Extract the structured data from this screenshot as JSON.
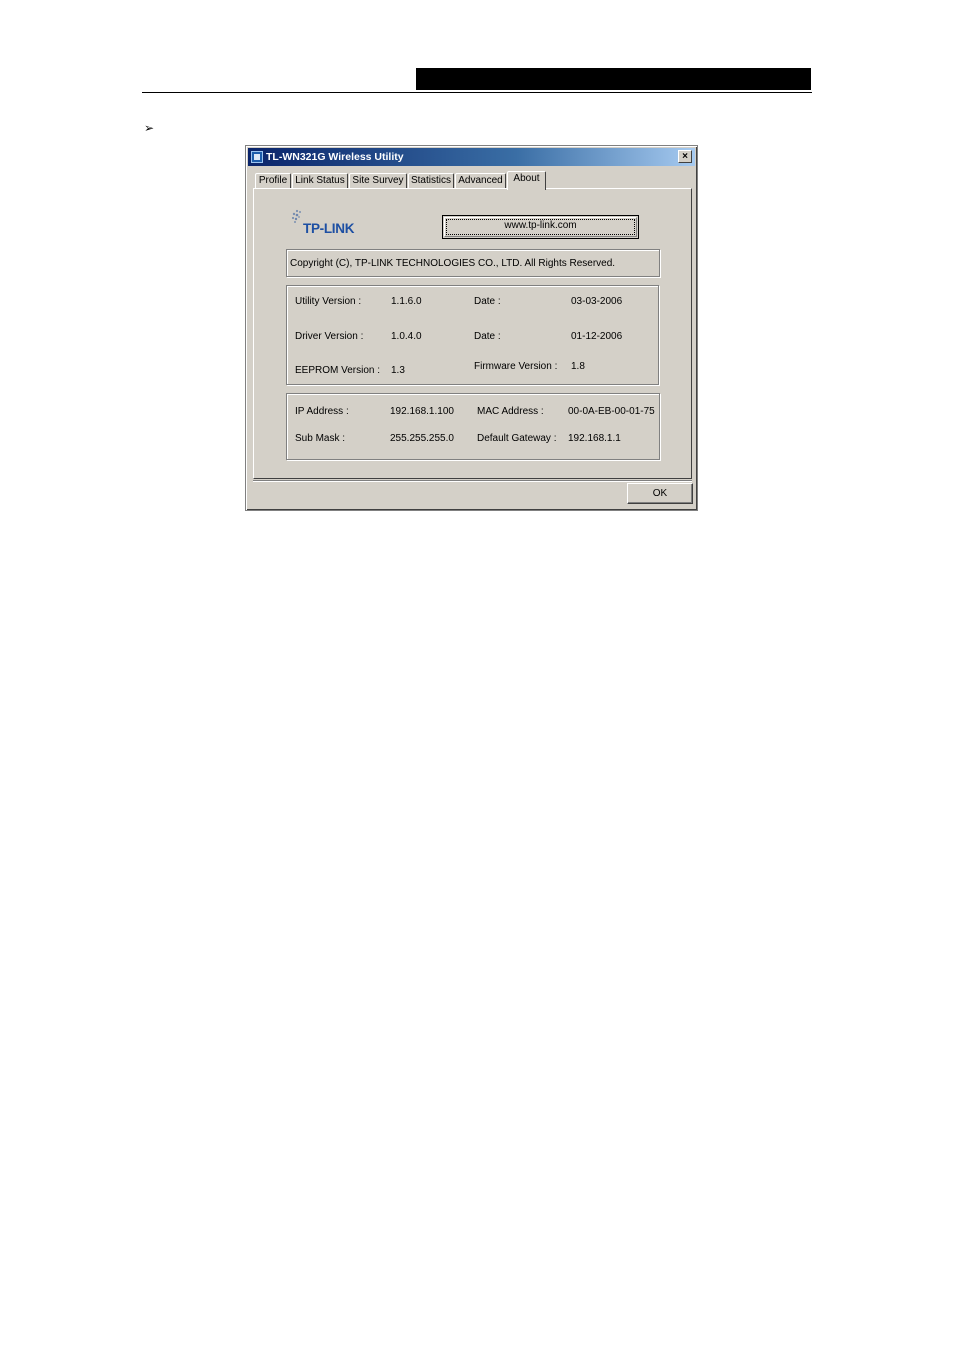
{
  "document": {
    "bullet": "Ø"
  },
  "window": {
    "title": "TL-WN321G Wireless Utility",
    "close_label": "×"
  },
  "tabs": [
    {
      "label": "Profile"
    },
    {
      "label": "Link Status"
    },
    {
      "label": "Site Survey"
    },
    {
      "label": "Statistics"
    },
    {
      "label": "Advanced"
    },
    {
      "label": "About",
      "active": true
    }
  ],
  "about": {
    "logo_text": "TP-LINK",
    "website_button": "www.tp-link.com",
    "copyright": "Copyright (C), TP-LINK TECHNOLOGIES CO., LTD. All Rights Reserved.",
    "versions": {
      "utility_label": "Utility Version :",
      "utility_value": "1.1.6.0",
      "utility_date_label": "Date :",
      "utility_date_value": "03-03-2006",
      "driver_label": "Driver Version :",
      "driver_value": "1.0.4.0",
      "driver_date_label": "Date :",
      "driver_date_value": "01-12-2006",
      "eeprom_label": "EEPROM Version :",
      "eeprom_value": "1.3",
      "firmware_label": "Firmware Version :",
      "firmware_value": "1.8"
    },
    "network": {
      "ip_label": "IP Address :",
      "ip_value": "192.168.1.100",
      "mac_label": "MAC Address :",
      "mac_value": "00-0A-EB-00-01-75",
      "mask_label": "Sub Mask :",
      "mask_value": "255.255.255.0",
      "gateway_label": "Default Gateway :",
      "gateway_value": "192.168.1.1"
    }
  },
  "footer": {
    "ok_label": "OK"
  },
  "colors": {
    "dialog_bg": "#d4d0c8",
    "title_gradient_start": "#0a246a",
    "title_gradient_end": "#a6caf0",
    "logo_blue": "#1d4fa3"
  }
}
